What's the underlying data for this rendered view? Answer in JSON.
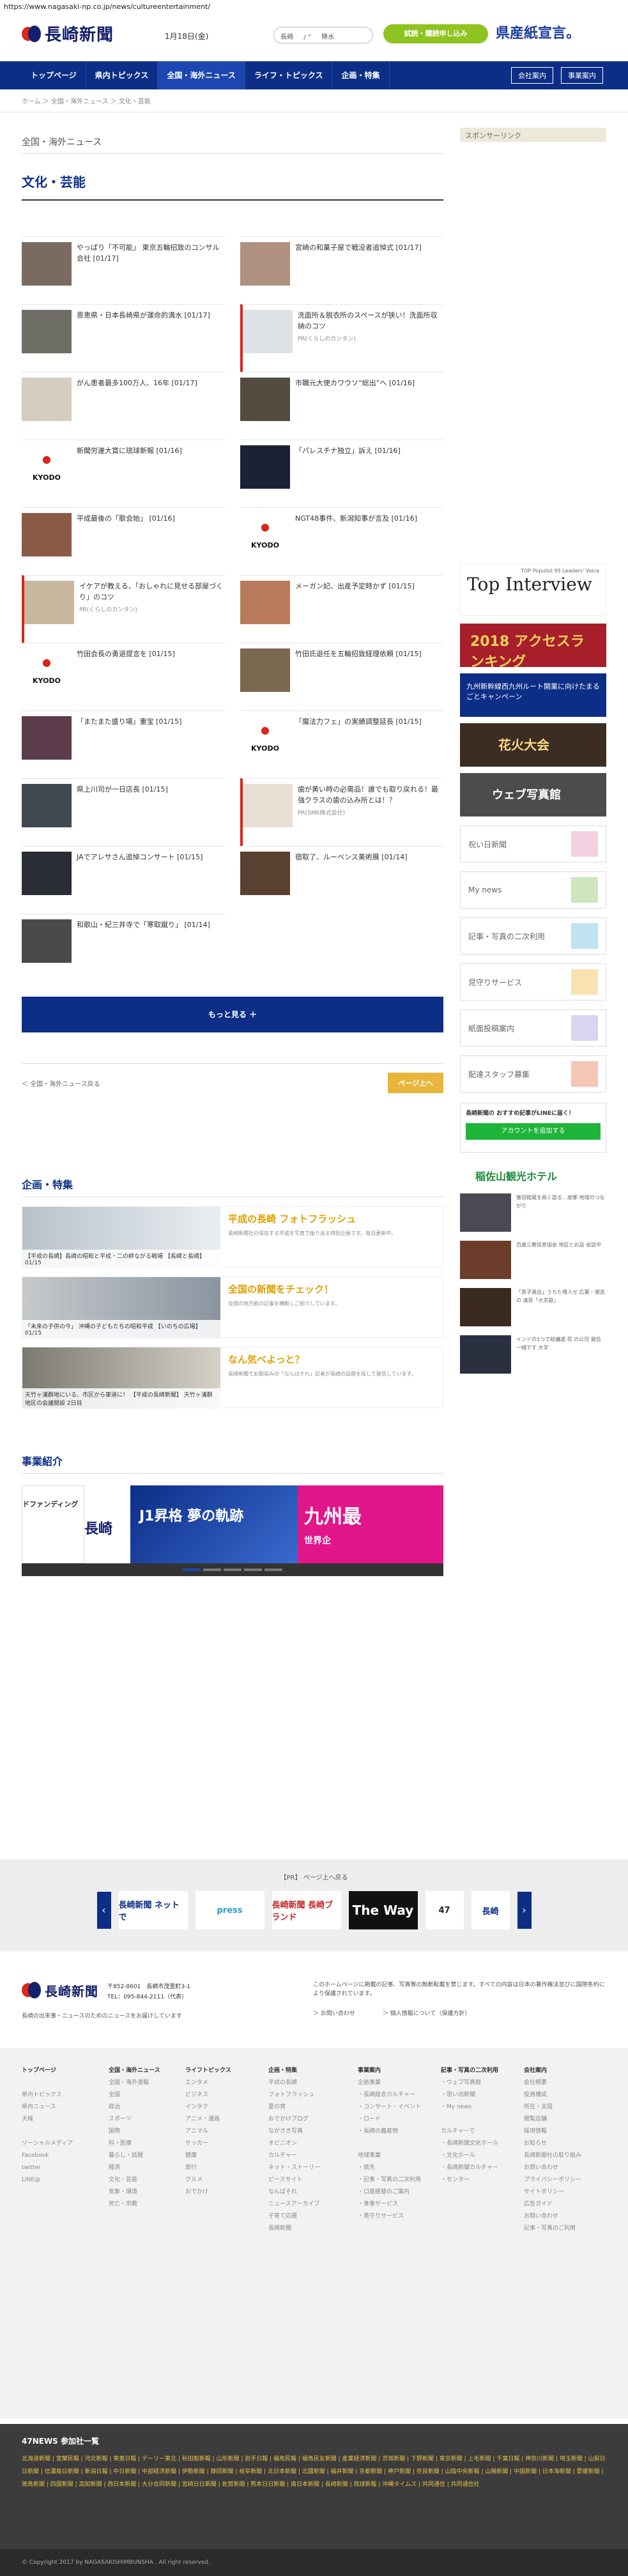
{
  "browser": {
    "url": "https://www.nagasaki-np.co.jp/news/cultureentertainment/"
  },
  "header": {
    "logo": "長崎新聞",
    "date": "1月18日(金)",
    "weather": "長崎 　 / ° 　 降水",
    "subscribe": "試読・購読申し込み",
    "ad": "県産紙宣言。"
  },
  "nav": {
    "items": [
      "トップページ",
      "県内トピックス",
      "全国・海外ニュース",
      "ライフ・トピックス",
      "企画・特集"
    ],
    "active": 2,
    "member": "会社案内",
    "business": "事業案内"
  },
  "breadcrumb": "ホーム ＞ 全国・海外ニュース ＞ 文化・芸能",
  "main": {
    "section": "全国・海外ニュース",
    "category": "文化・芸能",
    "articles": [
      {
        "text": "やっぱり「不可能」 東京五輪招致のコンサル会社 [01/17]",
        "sub": "",
        "color": "#7a6a60"
      },
      {
        "text": "宮崎の和菓子屋で戦没者追悼式 [01/17]",
        "sub": "",
        "color": "#b09080"
      },
      {
        "text": "恩恵県・日本長崎県が運命的満水 [01/17]",
        "sub": "",
        "color": "#6e6e66"
      },
      {
        "text": "洗面所＆脱衣所のスペースが狭い！洗面所収納のコツ",
        "sub": "PR(くらしのカンタン)",
        "color": "#dfe3e6"
      },
      {
        "text": "がん患者最多100万人、16年 [01/17]",
        "sub": "",
        "color": "#d4cdc0"
      },
      {
        "text": "市職元大使カワウソ“総出”へ [01/16]",
        "sub": "",
        "color": "#544b40"
      },
      {
        "text": "新聞労連大賞に琉球新報 [01/16]",
        "sub": "",
        "color": "kyodo"
      },
      {
        "text": "「パレスチナ独立」訴え [01/16]",
        "sub": "",
        "color": "#1a2233"
      },
      {
        "text": "平成最後の「歌会始」 [01/16]",
        "sub": "",
        "color": "#8b5a44"
      },
      {
        "text": "NGT48事件、新潟知事が言及 [01/16]",
        "sub": "",
        "color": "kyodo"
      },
      {
        "text": "イケアが教える、「おしゃれに見せる部屋づくり」のコツ",
        "sub": "PR(くらしのカンタン)",
        "color": "#c9b8a0"
      },
      {
        "text": "メーガン妃、出産予定時かず [01/15]",
        "sub": "",
        "color": "#b97b5b"
      },
      {
        "text": "竹田会長の勇退提言を [01/15]",
        "sub": "",
        "color": "kyodo"
      },
      {
        "text": "竹田氏退任を五輪招致経理依頼 [01/15]",
        "sub": "",
        "color": "#7a6750"
      },
      {
        "text": "「またまた盛り場」重宝 [01/15]",
        "sub": "",
        "color": "#5c3b4a"
      },
      {
        "text": "「魔法力フェ」の実績調整延長 [01/15]",
        "sub": "",
        "color": "kyodo"
      },
      {
        "text": "県上川司が一日店長 [01/15]",
        "sub": "",
        "color": "#404850"
      },
      {
        "text": "歯が黄い時の必需品！誰でも取り戻れる！最強クラスの歯の込み所とは！？",
        "sub": "PR(SMK株式会社)",
        "color": "#e8e0d4"
      },
      {
        "text": "JAでアレサさん追悼コンサート [01/15]",
        "sub": "",
        "color": "#2a2d33"
      },
      {
        "text": "宿取了、ルーベンス美術展 [01/14]",
        "sub": "",
        "color": "#5a4030"
      },
      {
        "text": "和歌山・紀三井寺で「寒取蹴り」 [01/14]",
        "sub": "",
        "color": "#4a4a4a"
      }
    ],
    "more": "もっと見る ＋",
    "pager_prev": "＜ 全国・海外ニュース戻る",
    "pager_next": "ページ上へ"
  },
  "features": {
    "title": "企画・特集",
    "items": [
      {
        "cap": "【平成の長崎】長崎の昭和と平成・二の絆ながる戦場 【長崎と長崎】 01/15",
        "title": "平成の長崎 フォトフラッシュ",
        "desc": "長崎新聞社の保存する平成を写真で振り返る特別企画です。毎日更新中。"
      },
      {
        "cap": "「未来の子供の今」 沖縄の子どもたちの昭和平成 【いのちの広場】 01/15",
        "title": "全国の新聞をチェック！",
        "desc": "全国の地方紙の記事を横断しご紹介しています。"
      },
      {
        "cap": "天竹ヶ浦群地にいる、市区から車道に！ 【平成の長崎新聞】 天竹ヶ浦群地区の会議開設 2日目",
        "title": "なん気べよっと？",
        "desc": "長崎新聞でお馴染みの「なんばそれ」記者が長崎の話題を探して発信しています。"
      }
    ]
  },
  "business": {
    "title": "事業紹介",
    "banners": [
      "ドファンディング",
      "長崎",
      "J1昇格 夢の軌跡",
      "九州最",
      "世界企"
    ]
  },
  "sidebar": {
    "sponsor": "スポンサーリンク",
    "topint_small": "TOP Populist 95 Leaders' Voice",
    "topint": "Top Interview",
    "rank_title": "2018 アクセスランキング",
    "campaign": "九州新幹線西九州ルート開業に向けたまるごとキャンペーン",
    "hanabi": "花火大会",
    "web": "ウェブ写真館",
    "tiles": [
      "祝い日新聞",
      "My news",
      "記事・写真の二次利用",
      "見守りサービス",
      "紙面投稿案内",
      "配達スタッフ募集"
    ],
    "line_text": "長崎新聞の おすすめ記事がLINEに届く！",
    "line_btn": "アカウントを追加する",
    "hotel": "稲佐山観光ホテル",
    "news": [
      "懐旧館蔵を熱く語る…故郷 地域のつながり",
      "百歳三教信息協会 地区とお話 会談中",
      "「男子進出」うちた場人せ 広葉・潮流の 演目「大京歌」",
      "インドの1つで結構選 花 の公司 発信 一緒です 大学"
    ]
  },
  "footer": {
    "prtitle": "【PR】 ページ上へ戻る",
    "logos": [
      "長崎新聞 ネットで",
      "press",
      "長崎新聞 長崎ブランド",
      "The Way",
      "47",
      "長崎"
    ],
    "addr": "〒852-8601　長崎市茂里町3-1",
    "tel": "TEL：095-844-2111（代表）",
    "copyline": "長崎の出来事・ニュースのためのニュースをお届けしています",
    "notice": "このホームページに掲載の記事、写真等の無断転載を禁じます。すべての内容は日本の著作権法並びに国際条約により保護されています。",
    "link1": "＞ お問い合わせ",
    "link2": "＞ 個人情報について（保護方針）",
    "sitemap": [
      {
        "h": "トップページ",
        "items": [
          "",
          "県内トピックス",
          "県内ニュース",
          "天候",
          "",
          "ソーシャルメディア",
          "Facebook",
          "twitter",
          "LINE@"
        ]
      },
      {
        "h": "全国・海外ニュース",
        "items": [
          "全国・海外速報",
          "全国",
          "政治",
          "スポーツ",
          "国際",
          "科・医療",
          "暮らし・話題",
          "経済",
          "文化・芸能",
          "気象・環境",
          "死亡・宗教"
        ]
      },
      {
        "h": "ライフトピックス",
        "items": [
          "エンタメ",
          "ビジネス",
          "インタク",
          "アニメ・漫画",
          "アニマル",
          "サッカー",
          "健康",
          "旅行",
          "グルメ",
          "おでかけ"
        ]
      },
      {
        "h": "企画・特集",
        "items": [
          "平成の長崎",
          "フォトフラッシュ",
          "夏の宵",
          "おでかけブログ",
          "ながさき写真",
          "オピニオン",
          "カルチャー",
          "ネット・ストーリー",
          "ピースサイト",
          "なんばそれ",
          "ニュースアーカイブ",
          "子育て応援",
          "長崎新聞"
        ]
      },
      {
        "h": "事業案内",
        "items": [
          "企画事業",
          "・長崎総合カルチャー",
          "・コンサート・イベント",
          "・ロード",
          "・長崎の農産物",
          "",
          "地域事業",
          "・旅先",
          "・記事・写真の二次利用",
          "・口座振替のご案内",
          "・食事サービス",
          "・見守りサービス"
        ]
      },
      {
        "h": "記事・写真の二次利用",
        "items": [
          "・ウェブ写真館",
          "・思い出新聞",
          "・My news",
          "",
          "カルチャーで",
          "・長崎新聞文化ホール",
          "・文化ホール",
          "・長崎新聞カルチャー",
          "・センター"
        ]
      },
      {
        "h": "会社案内",
        "items": [
          "会社概要",
          "役員構成",
          "所在・支局",
          "閲覧店舗",
          "採用情報",
          "お知らせ",
          "長崎新聞社の取り組み",
          "お問い合わせ",
          "プライバシーポリシー",
          "サイトポリシー",
          "広告ガイド",
          "お問い合わせ",
          "記事・写真のご利用"
        ]
      }
    ],
    "network_title": "47NEWS 参加社一覧",
    "network": "北海道新聞 | 室蘭民報 | 河北新報 | 東奥日報 | デーリー東北 | 秋田魁新報 | 山形新聞 | 岩手日報 | 福島民報 | 福島民友新聞 | 産業経済新聞 | 茨城新聞 | 下野新聞 | 東京新聞 | 上毛新聞 | 千葉日報 | 神奈川新聞 | 埼玉新聞 | 山梨日日新聞 | 信濃毎日新聞 | 新潟日報 | 中日新聞 | 中部経済新聞 | 伊勢新聞 | 静岡新聞 | 岐阜新聞 | 北日本新聞 | 北國新聞 | 福井新聞 | 京都新聞 | 神戸新聞 | 奈良新聞 | 山陰中央新報 | 山陽新聞 | 中国新聞 | 日本海新聞 | 愛媛新聞 | 徳島新聞 | 四国新聞 | 高知新聞 | 西日本新聞 | 大分合同新聞 | 宮崎日日新聞 | 佐賀新聞 | 熊本日日新聞 | 南日本新聞 | 長崎新聞 | 琉球新報 | 沖縄タイムス | 共同通信 | 共同通信社",
    "copyright": "© Copyright 2017 by NAGASAKISHIMBUNSHA . All right reserved."
  }
}
